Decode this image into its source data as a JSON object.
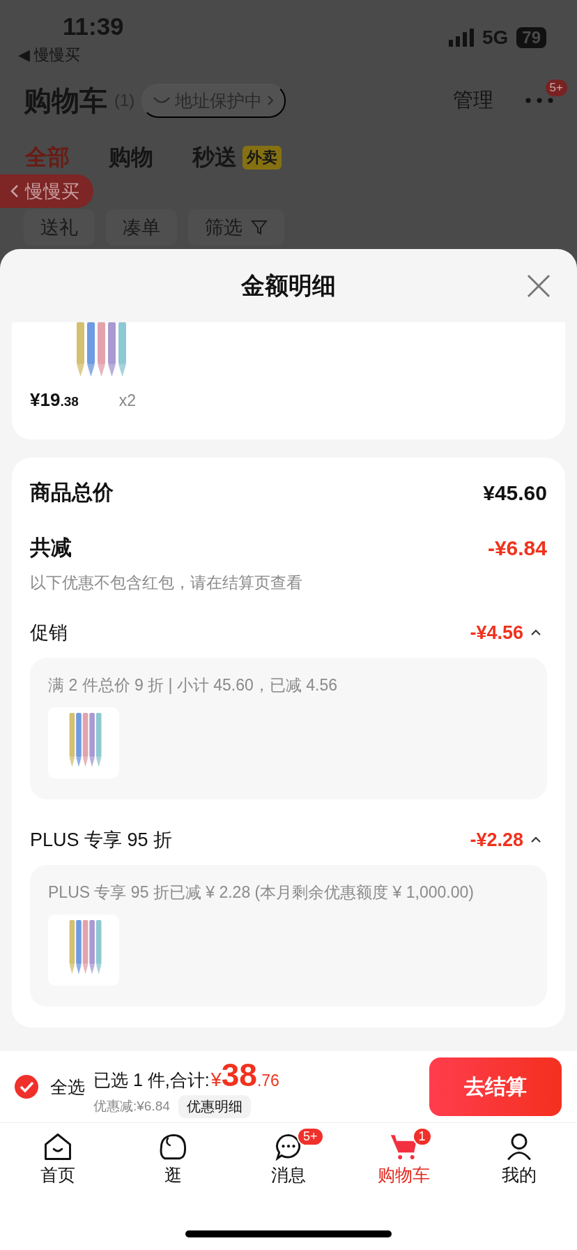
{
  "status_bar": {
    "time": "11:39",
    "back_arrow": "◀",
    "back_app": "慢慢买",
    "network": "5G",
    "battery": "79"
  },
  "header": {
    "title": "购物车",
    "count": "(1)",
    "address_chip": "地址保护中",
    "manage": "管理",
    "more_badge": "5+"
  },
  "tabs": [
    {
      "label": "全部",
      "selected": true
    },
    {
      "label": "购物",
      "selected": false
    },
    {
      "label": "秒送",
      "selected": false,
      "tag": "外卖"
    }
  ],
  "chips": [
    {
      "label": "送礼",
      "kind": "plain"
    },
    {
      "label": "凑单",
      "kind": "plain"
    },
    {
      "label": "筛选",
      "kind": "filter"
    }
  ],
  "back_pill": {
    "label": "慢慢买"
  },
  "sheet": {
    "title": "金额明细",
    "product": {
      "price_main": "¥19",
      "price_decimal": ".38",
      "quantity": "x2"
    },
    "summary": {
      "total_label": "商品总价",
      "total_value": "¥45.60",
      "reduce_label": "共减",
      "reduce_value": "-¥6.84",
      "note": "以下优惠不包含红包，请在结算页查看",
      "discounts": [
        {
          "label": "促销",
          "value": "-¥4.56",
          "expanded": true,
          "detail": "满 2 件总价 9 折 | 小计 45.60，已减 4.56"
        },
        {
          "label": "PLUS 专享 95 折",
          "value": "-¥2.28",
          "expanded": true,
          "detail": "PLUS 专享 95 折已减 ¥ 2.28 (本月剩余优惠额度 ¥ 1,000.00)"
        }
      ]
    }
  },
  "checkout": {
    "select_all": {
      "label": "全选",
      "checked": true
    },
    "selected_text": "已选 1 件,合计:",
    "total_symbol": "¥",
    "total_main": "38",
    "total_decimal": ".76",
    "saving": "优惠减:¥6.84",
    "detail_button": "优惠明细",
    "button": "去结算"
  },
  "tab_bar": {
    "items": [
      {
        "label": "首页",
        "kind": "home",
        "selected": false
      },
      {
        "label": "逛",
        "kind": "browse",
        "selected": false
      },
      {
        "label": "消息",
        "kind": "message",
        "selected": false,
        "badge": "5+"
      },
      {
        "label": "购物车",
        "kind": "cart",
        "selected": true,
        "badge": "1"
      },
      {
        "label": "我的",
        "kind": "profile",
        "selected": false
      }
    ]
  }
}
